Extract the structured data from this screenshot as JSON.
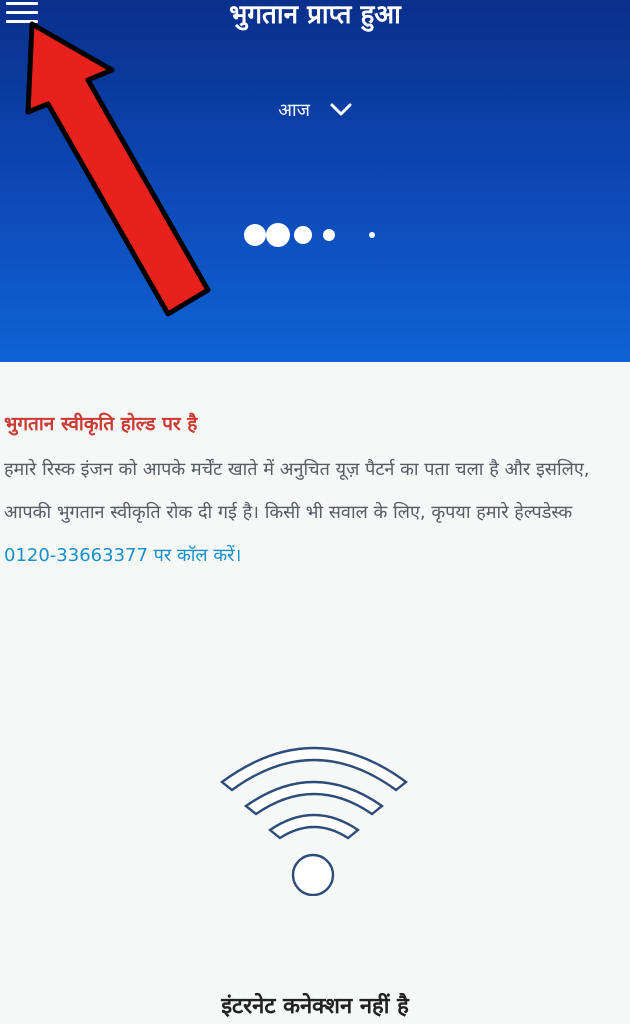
{
  "header": {
    "title": "भुगतान प्राप्त हुआ",
    "date_filter": "आज",
    "menu_icon": "hamburger-menu-icon",
    "filter_icon": "chevron-down-icon",
    "background_color": "#0d4ab8"
  },
  "notice": {
    "title": "भुगतान स्वीकृति होल्ड पर है",
    "body": "हमारे रिस्क इंजन को आपके मर्चेंट खाते में अनुचित यूज़ पैटर्न का पता चला है और इसलिए, आपकी भुगतान स्वीकृति रोक दी गई है। किसी भी सवाल के लिए, कृपया हमारे हेल्पडेस्क ",
    "phone_link": "0120-33663377 पर कॉल करें।",
    "title_color": "#cc3b33",
    "link_color": "#1790c9"
  },
  "offline": {
    "icon": "wifi-icon",
    "message": "इंटरनेट कनेक्शन नहीं है"
  },
  "annotation": {
    "icon": "red-arrow-icon",
    "color": "#e8211c"
  }
}
